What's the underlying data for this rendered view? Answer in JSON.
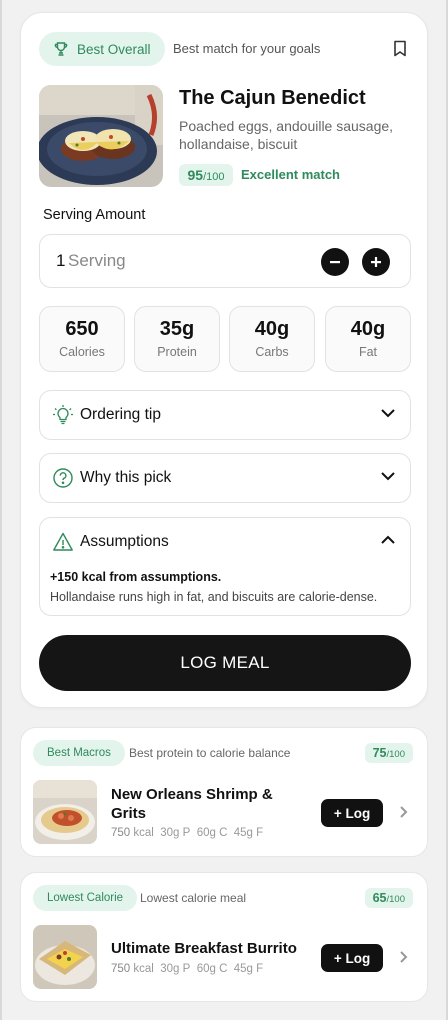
{
  "main": {
    "badge": "Best Overall",
    "badge_subtitle": "Best match for your goals",
    "title": "The Cajun Benedict",
    "description": "Poached eggs, andouille sausage, hollandaise, biscuit",
    "score": "95",
    "score_max": "/100",
    "match_label": "Excellent match",
    "serving_label": "Serving Amount",
    "serving_qty": "1",
    "serving_unit": "Serving",
    "macros": [
      {
        "value": "650",
        "label": "Calories"
      },
      {
        "value": "35g",
        "label": "Protein"
      },
      {
        "value": "40g",
        "label": "Carbs"
      },
      {
        "value": "40g",
        "label": "Fat"
      }
    ],
    "accordions": {
      "ordering_tip": "Ordering tip",
      "why_this_pick": "Why this pick",
      "assumptions": "Assumptions",
      "assumptions_bold": "+150 kcal from assumptions.",
      "assumptions_text": "Hollandaise runs high in fat, and biscuits are calorie-dense."
    },
    "log_button": "LOG MEAL"
  },
  "alternatives": [
    {
      "badge": "Best Macros",
      "reason": "Best protein to calorie balance",
      "score": "75",
      "score_max": "/100",
      "name": "New Orleans Shrimp & Grits",
      "kcal": "750",
      "kcal_unit": "kcal",
      "protein": "30g P",
      "carbs": "60g C",
      "fat": "45g F",
      "log_label": "+ Log"
    },
    {
      "badge": "Lowest Calorie",
      "reason": "Lowest calorie meal",
      "score": "65",
      "score_max": "/100",
      "name": "Ultimate Breakfast Burrito",
      "kcal": "750",
      "kcal_unit": "kcal",
      "protein": "30g P",
      "carbs": "60g C",
      "fat": "45g F",
      "log_label": "+ Log"
    }
  ],
  "colors": {
    "accent_green": "#2f8a5c",
    "pill_bg": "#e3f4ec",
    "button_dark": "#151515"
  },
  "icons": {
    "badge": "trophy-icon",
    "save": "bookmark-icon",
    "ordering_tip": "lightbulb-icon",
    "why_this_pick": "question-circle-icon",
    "assumptions": "warning-triangle-icon"
  }
}
